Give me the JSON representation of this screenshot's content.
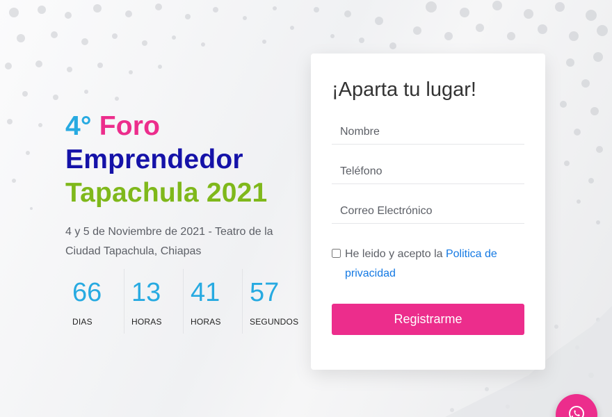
{
  "hero": {
    "title_number": "4°",
    "title_foro": "Foro",
    "title_emprendedor": "Emprendedor",
    "title_city_year": "Tapachula 2021",
    "subtitle": "4 y 5 de Noviembre de 2021 - Teatro de la Ciudad Tapachula, Chiapas"
  },
  "countdown": [
    {
      "value": "66",
      "label": "DIAS"
    },
    {
      "value": "13",
      "label": "HORAS"
    },
    {
      "value": "41",
      "label": "HORAS"
    },
    {
      "value": "57",
      "label": "SEGUNDOS"
    }
  ],
  "form": {
    "title": "¡Aparta tu lugar!",
    "name_placeholder": "Nombre",
    "phone_placeholder": "Teléfono",
    "email_placeholder": "Correo Electrónico",
    "consent_text": "He leido y acepto la ",
    "consent_link": "Politica de privacidad",
    "consent_checked": false,
    "submit_label": "Registrarme"
  },
  "colors": {
    "blue": "#27aae1",
    "pink": "#ec2d8c",
    "navy": "#1512a8",
    "green": "#7fb81b",
    "link": "#1479e3"
  },
  "icons": {
    "floating_button": "whatsapp-icon"
  }
}
